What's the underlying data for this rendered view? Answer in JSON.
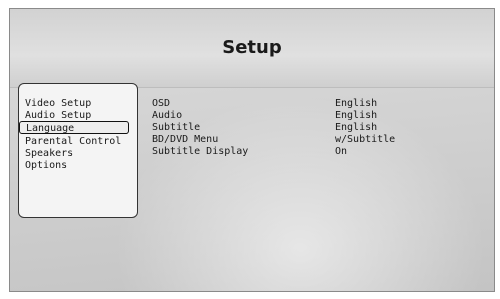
{
  "title": "Setup",
  "menu": {
    "items": [
      "Video Setup",
      "Audio Setup",
      "Language",
      "Parental Control",
      "Speakers",
      "Options"
    ],
    "selected_index": 2
  },
  "settings": [
    {
      "label": "OSD",
      "value": "English"
    },
    {
      "label": "Audio",
      "value": "English"
    },
    {
      "label": "Subtitle",
      "value": "English"
    },
    {
      "label": "BD/DVD Menu",
      "value": "w/Subtitle"
    },
    {
      "label": "Subtitle Display",
      "value": "On"
    }
  ]
}
